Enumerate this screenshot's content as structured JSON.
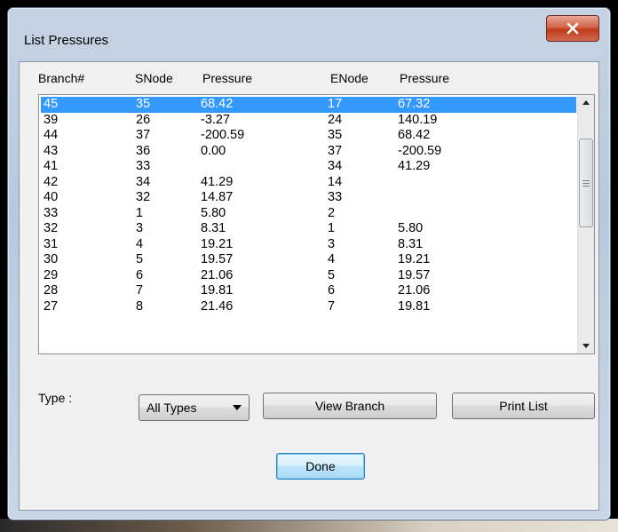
{
  "window": {
    "title": "List Pressures"
  },
  "columns": {
    "branch": "Branch#",
    "snode": "SNode",
    "spressure": "Pressure",
    "enode": "ENode",
    "epressure": "Pressure"
  },
  "rows": [
    {
      "branch": "45",
      "snode": "35",
      "spressure": "68.42",
      "enode": "17",
      "epressure": "67.32",
      "selected": true
    },
    {
      "branch": "39",
      "snode": "26",
      "spressure": "-3.27",
      "enode": "24",
      "epressure": "140.19"
    },
    {
      "branch": "44",
      "snode": "37",
      "spressure": "-200.59",
      "enode": "35",
      "epressure": "68.42"
    },
    {
      "branch": "43",
      "snode": "36",
      "spressure": "0.00",
      "enode": "37",
      "epressure": "-200.59"
    },
    {
      "branch": "41",
      "snode": "33",
      "spressure": "",
      "enode": "34",
      "epressure": "41.29"
    },
    {
      "branch": "42",
      "snode": "34",
      "spressure": "41.29",
      "enode": "14",
      "epressure": ""
    },
    {
      "branch": "40",
      "snode": "32",
      "spressure": "14.87",
      "enode": "33",
      "epressure": ""
    },
    {
      "branch": "33",
      "snode": "1",
      "spressure": "5.80",
      "enode": "2",
      "epressure": ""
    },
    {
      "branch": "32",
      "snode": "3",
      "spressure": "8.31",
      "enode": "1",
      "epressure": "5.80"
    },
    {
      "branch": "31",
      "snode": "4",
      "spressure": "19.21",
      "enode": "3",
      "epressure": "8.31"
    },
    {
      "branch": "30",
      "snode": "5",
      "spressure": "19.57",
      "enode": "4",
      "epressure": "19.21"
    },
    {
      "branch": "29",
      "snode": "6",
      "spressure": "21.06",
      "enode": "5",
      "epressure": "19.57"
    },
    {
      "branch": "28",
      "snode": "7",
      "spressure": "19.81",
      "enode": "6",
      "epressure": "21.06"
    },
    {
      "branch": "27",
      "snode": "8",
      "spressure": "21.46",
      "enode": "7",
      "epressure": "19.81"
    }
  ],
  "controls": {
    "type_label": "Type :",
    "type_select_value": "All Types",
    "view_branch_label": "View Branch",
    "print_list_label": "Print List",
    "done_label": "Done"
  },
  "colors": {
    "selection": "#3399ff",
    "close_button": "#c0391b"
  },
  "icons": {
    "close": "close-icon",
    "scroll_up": "scroll-up-arrow-icon",
    "scroll_down": "scroll-down-arrow-icon",
    "dropdown": "chevron-down-icon"
  }
}
